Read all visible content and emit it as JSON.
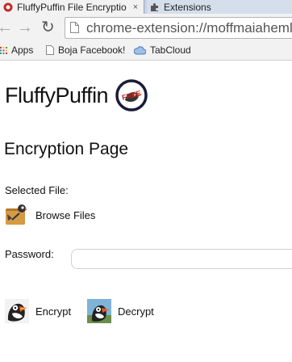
{
  "tabs": [
    {
      "title": "FluffyPuffin File Encryptio",
      "close": "×"
    },
    {
      "title": "Extensions",
      "close": ""
    }
  ],
  "toolbar": {
    "back": "←",
    "forward": "→",
    "reload": "↻",
    "url": "chrome-extension://moffmaiahemlbj"
  },
  "bookmarks": [
    {
      "label": "Apps"
    },
    {
      "label": "Boja Facebook!"
    },
    {
      "label": "TabCloud"
    }
  ],
  "page": {
    "brand": "FluffyPuffin",
    "logo_text": "FREE",
    "title": "Encryption Page",
    "selected_file_label": "Selected File:",
    "browse_label": "Browse Files",
    "password_label": "Password:",
    "password_value": "",
    "encrypt_label": "Encrypt",
    "decrypt_label": "Decrypt"
  },
  "colors": {
    "tabstrip": "#c6d2e4",
    "toolbar": "#f2f2f2",
    "logo_ring": "#1a1a3a",
    "logo_text": "#cc2222"
  }
}
